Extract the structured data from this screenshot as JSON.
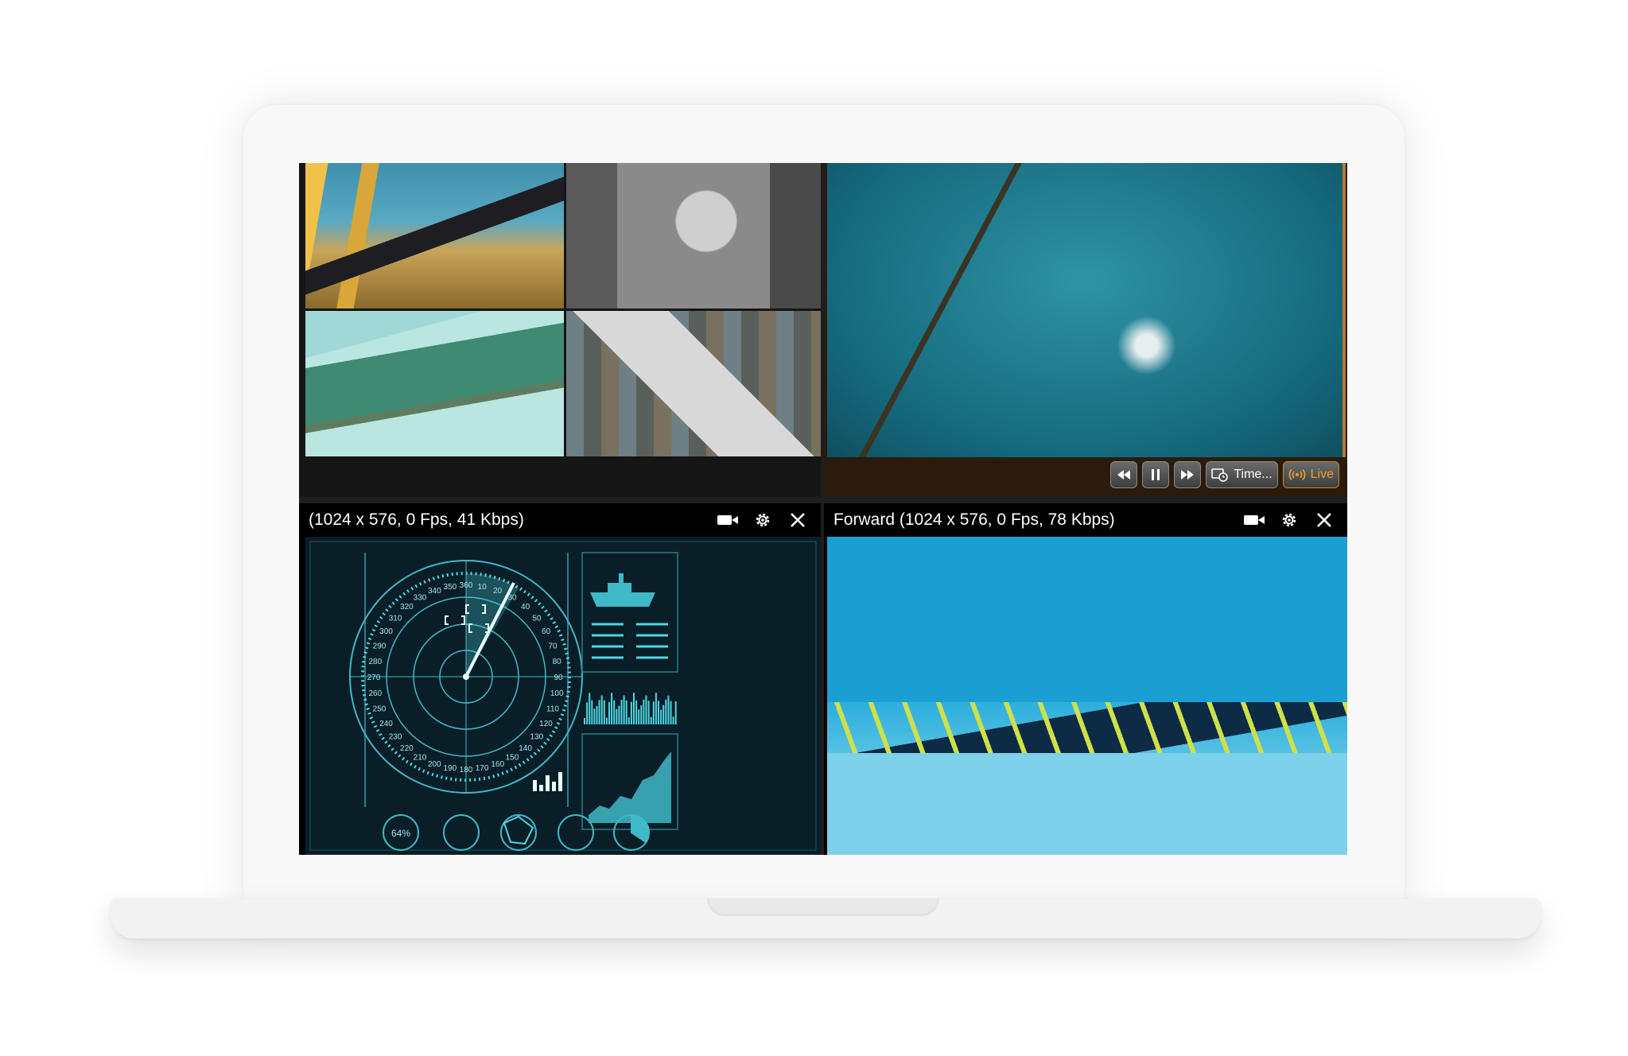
{
  "panes": {
    "bottom_left": {
      "title": "(1024 x 576, 0 Fps, 41 Kbps)"
    },
    "bottom_right": {
      "title": "Forward (1024 x 576, 0 Fps, 78 Kbps)"
    },
    "top_right": {
      "controls": {
        "rewind": "rewind-icon",
        "pause": "pause-icon",
        "forward": "fast-forward-icon",
        "timeline_label": "Time...",
        "live_label": "Live"
      }
    }
  },
  "radar": {
    "bearing_labels": [
      "360",
      "10",
      "20",
      "30",
      "40",
      "50",
      "60",
      "70",
      "80",
      "90",
      "100",
      "110",
      "120",
      "130",
      "140",
      "150",
      "160",
      "170",
      "180",
      "190",
      "200",
      "210",
      "220",
      "230",
      "240",
      "250",
      "260",
      "270",
      "280",
      "290",
      "300",
      "310",
      "320",
      "330",
      "340",
      "350"
    ],
    "gauge_label": "64%"
  },
  "colors": {
    "accent_orange": "#f0a028",
    "pane_border": "#b47a2c",
    "radar_cyan": "#4fd6e3"
  }
}
